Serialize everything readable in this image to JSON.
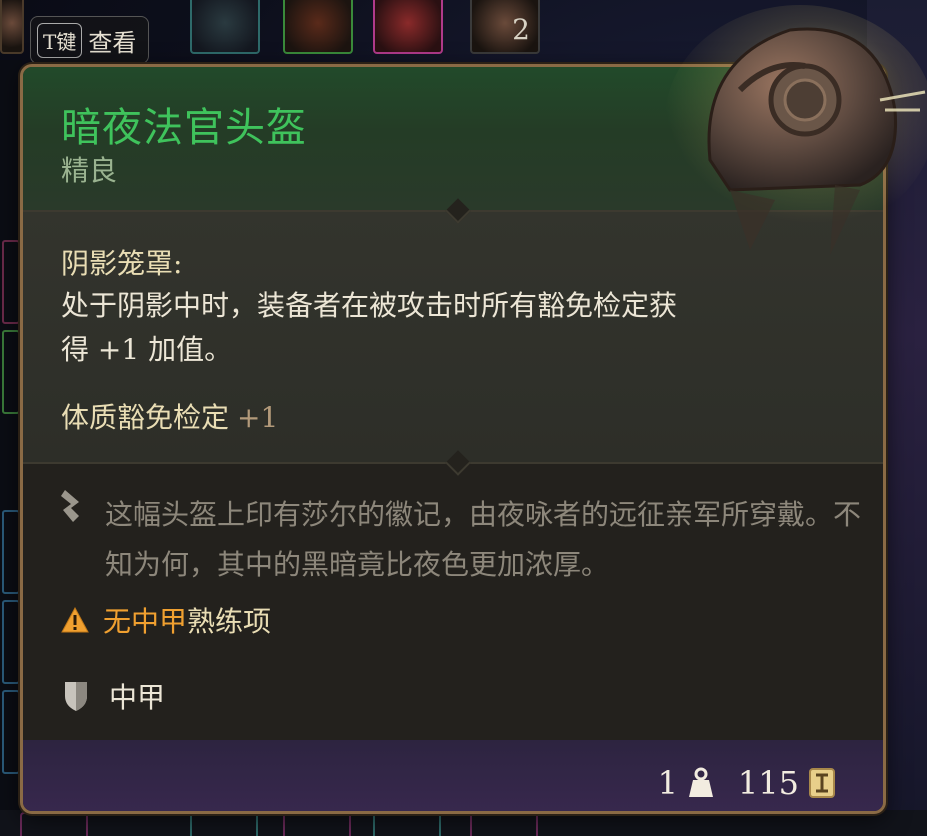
{
  "inventory": {
    "stack_count": "2"
  },
  "key_hint": {
    "key": "T键",
    "label": "查看"
  },
  "item": {
    "name": "暗夜法官头盔",
    "rarity": "精良",
    "passive": {
      "title": "阴影笼罩:",
      "description": "处于阴影中时，装备者在被攻击时所有豁免检定获得 +1 加值。"
    },
    "bonus": {
      "label": "体质豁免检定",
      "value": "+1"
    },
    "lore": "这幅头盔上印有莎尔的徽记，由夜咏者的远征亲军所穿戴。不知为何，其中的黑暗竟比夜色更加浓厚。",
    "proficiency": {
      "missing": "无中甲",
      "rest": "熟练项"
    },
    "armor_type": "中甲",
    "weight": "1",
    "price": "115"
  },
  "colors": {
    "title": "#3fc35c",
    "rarity": "#9ab390",
    "warning": "#f0a030",
    "border": "#8a6a45",
    "footer": "#38284e"
  },
  "icons": {
    "lore": "quill-icon",
    "warning": "warning-triangle-icon",
    "armor": "shield-icon",
    "weight": "weight-icon",
    "price": "gold-coin-icon"
  }
}
